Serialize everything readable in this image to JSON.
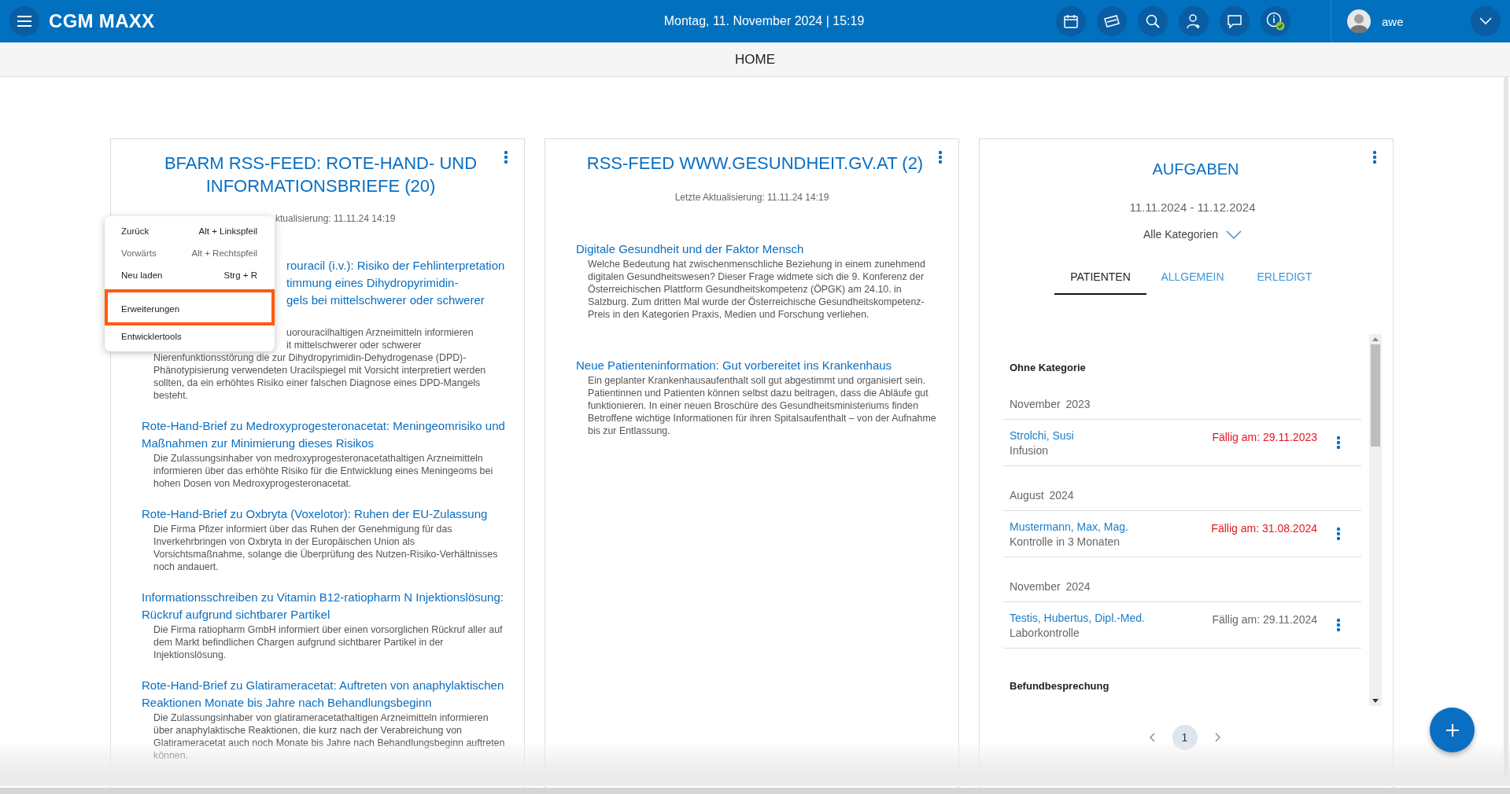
{
  "topbar": {
    "logo": "CGM MAXX",
    "datetime": "Montag, 11. November 2024 | 15:19",
    "user": "awe"
  },
  "page_title": "HOME",
  "feeds": [
    {
      "title": "BFARM RSS-FEED: ROTE-HAND- UND INFORMATIONSBRIEFE (20)",
      "updated_fragment": "ktualisierung: 11.11.24 14:19",
      "articles": [
        {
          "kind": "partly-covered",
          "title_fragments": [
            "rouracil (i.v.): Risiko der Fehlinterpretation",
            "timmung eines Dihydropyrimidin-",
            "gels bei mittelschwerer oder schwerer"
          ],
          "summary_fragments": [
            "uorouracilhaltigen Arzneimitteln informieren",
            "it mittelschwerer oder schwerer"
          ],
          "summary": "Nierenfunktionsstörung die zur Dihydropyrimidin-Dehydrogenase (DPD)-Phänotypisierung verwendeten Uracilspiegel mit Vorsicht interpretiert werden sollten, da ein erhöhtes Risiko einer falschen Diagnose eines DPD-Mangels besteht."
        },
        {
          "kind": "full",
          "title": "Rote-Hand-Brief zu Medroxyprogesteronacetat: Meningeomrisiko und Maßnahmen zur Minimierung dieses Risikos",
          "summary": "Die Zulassungsinhaber von medroxyprogesteronacetathaltigen Arzneimitteln informieren über das erhöhte Risiko für die Entwicklung eines Meningeoms bei hohen Dosen von Medroxyprogesteronacetat."
        },
        {
          "kind": "full",
          "title": "Rote-Hand-Brief zu Oxbryta (Voxelotor): Ruhen der EU-Zulassung",
          "summary": "Die Firma Pfizer informiert über das Ruhen der Genehmigung für das Inverkehrbringen von Oxbryta in der Europäischen Union als Vorsichtsmaßnahme, solange die Überprüfung des Nutzen-Risiko-Verhältnisses noch andauert."
        },
        {
          "kind": "full",
          "title": "Informationsschreiben zu Vitamin B12-ratiopharm N Injektionslösung: Rückruf aufgrund sichtbarer Partikel",
          "summary": "Die Firma ratiopharm GmbH informiert über einen vorsorglichen Rückruf aller auf dem Markt befindlichen Chargen aufgrund sichtbarer Partikel in der Injektionslösung."
        },
        {
          "kind": "full",
          "title": "Rote-Hand-Brief zu Glatirameracetat: Auftreten von anaphylaktischen Reaktionen Monate bis Jahre nach Behandlungsbeginn",
          "summary": "Die Zulassungsinhaber von glatirameracetathaltigen Arzneimitteln informieren über anaphylaktische Reaktionen, die kurz nach der Verabreichung von Glatirameracetat auch noch Monate bis Jahre nach Behandlungsbeginn auftreten können."
        }
      ]
    },
    {
      "title": "RSS-FEED WWW.GESUNDHEIT.GV.AT (2)",
      "updated": "Letzte Aktualisierung: 11.11.24 14:19",
      "articles": [
        {
          "kind": "full",
          "title": "Digitale Gesundheit und der Faktor Mensch",
          "summary": "Welche Bedeutung hat zwischenmenschliche Beziehung in einem zunehmend digitalen Gesundheitswesen? Dieser Frage widmete sich die 9. Konferenz der Österreichischen Plattform Gesundheitskompetenz (ÖPGK) am 24.10. in Salzburg. Zum dritten Mal wurde der Österreichische Gesundheitskompetenz-Preis in den Kategorien Praxis, Medien und Forschung verliehen."
        },
        {
          "kind": "full",
          "title": "Neue Patienteninformation: Gut vorbereitet ins Krankenhaus",
          "summary": "Ein geplanter Krankenhausaufenthalt soll gut abgestimmt und organisiert sein. Patientinnen und Patienten können selbst dazu beitragen, dass die Abläufe gut funktionieren. In einer neuen Broschüre des Gesundheitsministeriums finden Betroffene wichtige Informationen für ihren Spitalsaufenthalt – von der Aufnahme bis zur Entlassung."
        }
      ]
    }
  ],
  "tasks": {
    "title": "AUFGABEN",
    "range": "11.11.2024 - 11.12.2024",
    "category_filter": "Alle Kategorien",
    "tabs": [
      {
        "label": "PATIENTEN",
        "selected": true
      },
      {
        "label": "ALLGEMEIN",
        "selected": false
      },
      {
        "label": "ERLEDIGT",
        "selected": false
      }
    ],
    "list": [
      {
        "kind": "category",
        "label": "Ohne Kategorie"
      },
      {
        "kind": "month",
        "label": "November  2023"
      },
      {
        "kind": "task",
        "name": "Strolchi, Susi",
        "detail": "Infusion",
        "due": "Fällig am: 29.11.2023",
        "overdue": true
      },
      {
        "kind": "month",
        "label": "August  2024"
      },
      {
        "kind": "task",
        "name": "Mustermann, Max, Mag.",
        "detail": "Kontrolle in 3 Monaten",
        "due": "Fällig am: 31.08.2024",
        "overdue": true
      },
      {
        "kind": "month",
        "label": "November  2024"
      },
      {
        "kind": "task",
        "name": "Testis, Hubertus, Dipl.-Med.",
        "detail": "Laborkontrolle",
        "due": "Fällig am: 29.11.2024",
        "overdue": false
      },
      {
        "kind": "category",
        "label": "Befundbesprechung"
      }
    ],
    "pages": [
      {
        "label": "1",
        "selected": true
      }
    ]
  },
  "context_menu": [
    {
      "label": "Zurück",
      "shortcut": "Alt + Linkspfeil",
      "disabled": false,
      "highlighted": false
    },
    {
      "label": "Vorwärts",
      "shortcut": "Alt + Rechtspfeil",
      "disabled": true,
      "highlighted": false
    },
    {
      "label": "Neu laden",
      "shortcut": "Strg + R",
      "disabled": false,
      "highlighted": false
    },
    {
      "label": "Erweiterungen",
      "disabled": false,
      "highlighted": true
    },
    {
      "label": "Entwicklertools",
      "disabled": false,
      "highlighted": false
    }
  ]
}
